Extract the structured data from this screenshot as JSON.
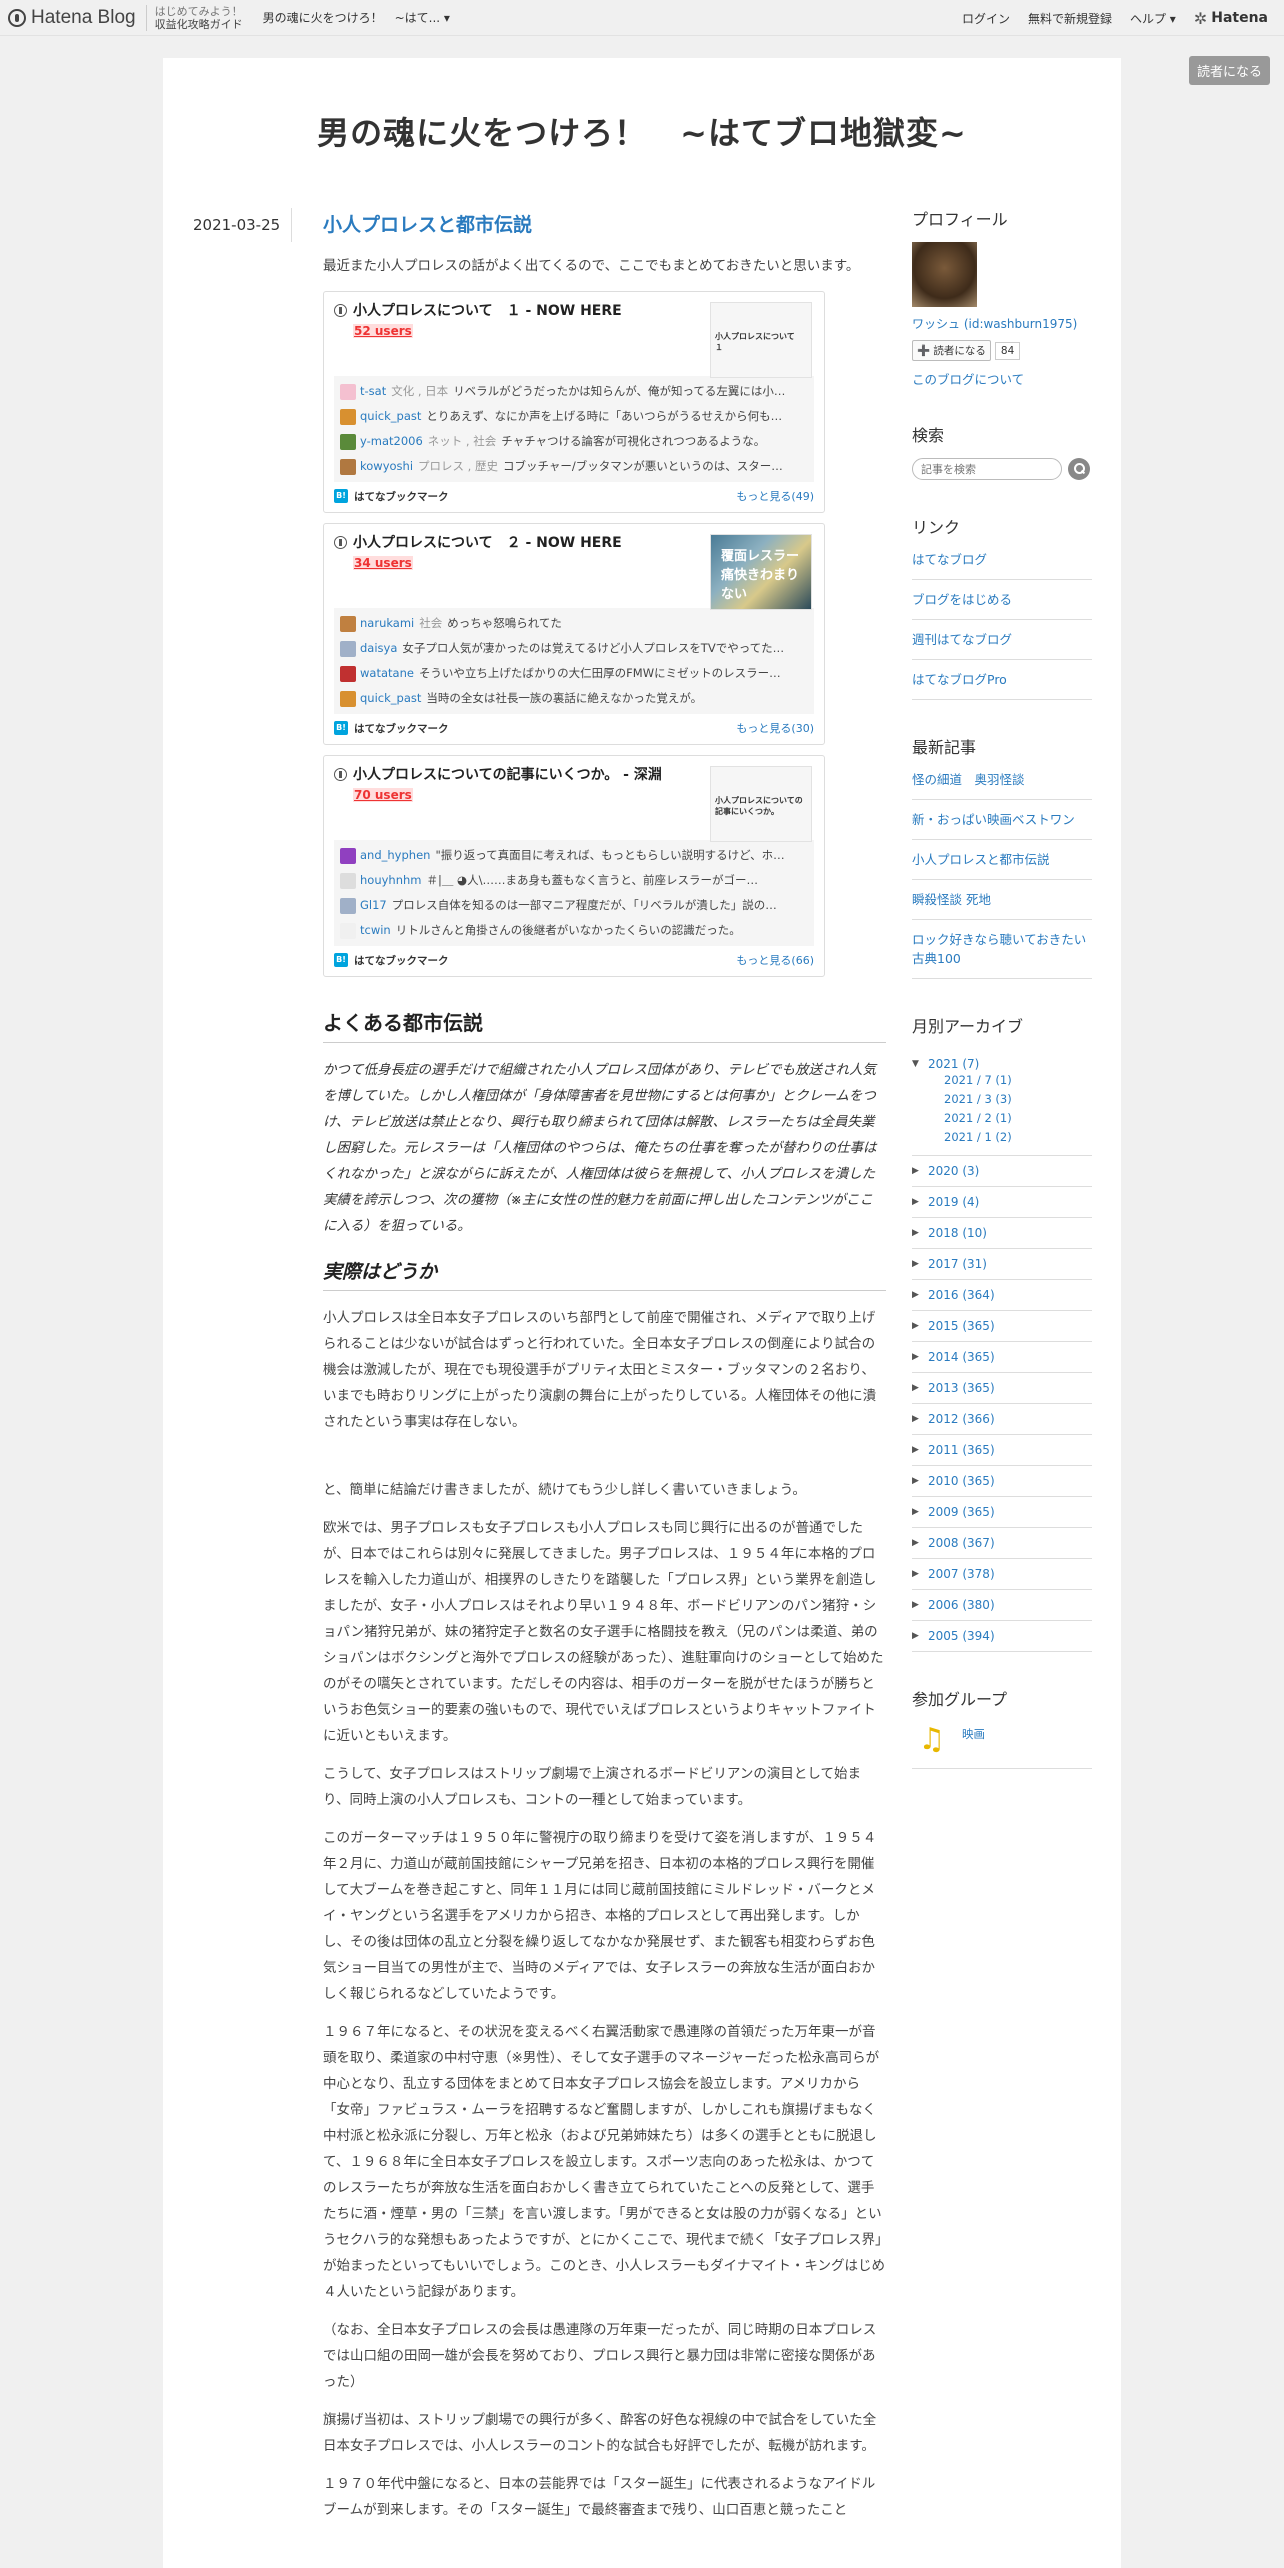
{
  "globalbar": {
    "logo_text": "Hatena Blog",
    "guide_small": "はじめてみよう！",
    "guide": "収益化攻略ガイド",
    "blog_short": "男の魂に火をつけろ！　~はて... ▾",
    "login": "ログイン",
    "signup": "無料で新規登録",
    "help": "ヘルプ ▾",
    "hatena": "Hatena"
  },
  "subscribe_button": "読者になる",
  "blog_title": "男の魂に火をつけろ！　~はてブロ地獄変~",
  "entry": {
    "date": "2021-03-25",
    "title": "小人プロレスと都市伝説",
    "intro": "最近また小人プロレスの話がよく出てくるので、ここでもまとめておきたいと思います。"
  },
  "bookmark_cards": [
    {
      "title": "小人プロレスについて　１ - NOW HERE",
      "users": "52 users",
      "thumb_text": "小人プロレスについて　１",
      "thumb_style": "text",
      "comments": [
        {
          "user": "t-sat",
          "tags": "文化 , 日本",
          "text": "リベラルがどうだったかは知らんが、俺が知ってる左翼には小…",
          "color": "#f4c0d0"
        },
        {
          "user": "quick_past",
          "tags": "",
          "text": "とりあえず、なにか声を上げる時に「あいつらがうるせえから何も…",
          "color": "#d89030"
        },
        {
          "user": "y-mat2006",
          "tags": "ネット , 社会",
          "text": "チャチャつける論客が可視化されつつあるような。",
          "color": "#5a8a3a"
        },
        {
          "user": "kowyoshi",
          "tags": "プロレス , 歴史",
          "text": "コブッチャー/ブッタマンが悪いというのは、スター…",
          "color": "#b07840"
        }
      ],
      "footer": "はてなブックマーク",
      "more": "もっと見る(49)"
    },
    {
      "title": "小人プロレスについて　２ - NOW HERE",
      "users": "34 users",
      "thumb_text": "覆面レスラー 痛快きわまりない",
      "thumb_style": "image",
      "comments": [
        {
          "user": "narukami",
          "tags": "社会",
          "text": "めっちゃ怒鳴られてた",
          "color": "#c08040"
        },
        {
          "user": "daisya",
          "tags": "",
          "text": "女子プロ人気が凄かったのは覚えてるけど小人プロレスをTVでやってた…",
          "color": "#a0b0c8"
        },
        {
          "user": "watatane",
          "tags": "",
          "text": "そういや立ち上げたばかりの大仁田厚のFMWにミゼットのレスラー…",
          "color": "#c03030"
        },
        {
          "user": "quick_past",
          "tags": "",
          "text": "当時の全女は社長一族の裏話に絶えなかった覚えが。",
          "color": "#d89030"
        }
      ],
      "footer": "はてなブックマーク",
      "more": "もっと見る(30)"
    },
    {
      "title": "小人プロレスについての記事にいくつか。 - 深淵",
      "users": "70 users",
      "thumb_text": "小人プロレスについての記事にいくつか。",
      "thumb_style": "text",
      "comments": [
        {
          "user": "and_hyphen",
          "tags": "",
          "text": "\"振り返って真面目に考えれば、もっともらしい説明するけど、ホ…",
          "color": "#9040c0"
        },
        {
          "user": "houyhnhm",
          "tags": "",
          "text": "＃|＿ ◕人\\……まあ身も蓋もなく言うと、前座レスラーがゴー…",
          "color": "#dddddd"
        },
        {
          "user": "Gl17",
          "tags": "",
          "text": "プロレス自体を知るのは一部マニア程度だが、「リベラルが潰した」説の…",
          "color": "#a0b0c8"
        },
        {
          "user": "tcwin",
          "tags": "",
          "text": "リトルさんと角掛さんの後継者がいなかったくらいの認識だった。",
          "color": "#f0f0f0"
        }
      ],
      "footer": "はてなブックマーク",
      "more": "もっと見る(66)"
    }
  ],
  "section1": {
    "heading": "よくある都市伝説",
    "text": "かつて低身長症の選手だけで組織された小人プロレス団体があり、テレビでも放送され人気を博していた。しかし人権団体が「身体障害者を見世物にするとは何事か」とクレームをつけ、テレビ放送は禁止となり、興行も取り締まられて団体は解散、レスラーたちは全員失業し困窮した。元レスラーは「人権団体のやつらは、俺たちの仕事を奪ったが替わりの仕事はくれなかった」と涙ながらに訴えたが、人権団体は彼らを無視して、小人プロレスを潰した実績を誇示しつつ、次の獲物（※主に女性の性的魅力を前面に押し出したコンテンツがここに入る）を狙っている。"
  },
  "section2": {
    "heading": "実際はどうか",
    "paragraphs": [
      "小人プロレスは全日本女子プロレスのいち部門として前座で開催され、メディアで取り上げられることは少ないが試合はずっと行われていた。全日本女子プロレスの倒産により試合の機会は激減したが、現在でも現役選手がプリティ太田とミスター・ブッタマンの２名おり、いまでも時おりリングに上がったり演劇の舞台に上がったりしている。人権団体その他に潰されたという事実は存在しない。",
      "と、簡単に結論だけ書きましたが、続けてもう少し詳しく書いていきましょう。",
      " 欧米では、男子プロレスも女子プロレスも小人プロレスも同じ興行に出るのが普通でしたが、日本ではこれらは別々に発展してきました。男子プロレスは、１９５４年に本格的プロレスを輸入した力道山が、相撲界のしきたりを踏襲した「プロレス界」という業界を創造しましたが、女子・小人プロレスはそれより早い１９４８年、ボードビリアンのパン猪狩・ショパン猪狩兄弟が、妹の猪狩定子と数名の女子選手に格闘技を教え（兄のパンは柔道、弟のショパンはボクシングと海外でプロレスの経験があった）、進駐軍向けのショーとして始めたのがその嚆矢とされています。ただしその内容は、相手のガーターを脱がせたほうが勝ちというお色気ショー的要素の強いもので、現代でいえばプロレスというよりキャットファイトに近いともいえます。",
      "こうして、女子プロレスはストリップ劇場で上演されるボードビリアンの演目として始まり、同時上演の小人プロレスも、コントの一種として始まっています。",
      "このガーターマッチは１９５０年に警視庁の取り締まりを受けて姿を消しますが、１９５４年２月に、力道山が蔵前国技館にシャープ兄弟を招き、日本初の本格的プロレス興行を開催して大ブームを巻き起こすと、同年１１月には同じ蔵前国技館にミルドレッド・バークとメイ・ヤングという名選手をアメリカから招き、本格的プロレスとして再出発します。しかし、その後は団体の乱立と分裂を繰り返してなかなか発展せず、また観客も相変わらずお色気ショー目当ての男性が主で、当時のメディアでは、女子レスラーの奔放な生活が面白おかしく報じられるなどしていたようです。",
      "１９６７年になると、その状況を変えるべく右翼活動家で愚連隊の首領だった万年東一が音頭を取り、柔道家の中村守恵（※男性）、そして女子選手のマネージャーだった松永高司らが中心となり、乱立する団体をまとめて日本女子プロレス協会を設立します。アメリカから「女帝」ファビュラス・ムーラを招聘するなど奮闘しますが、しかしこれも旗揚げまもなく中村派と松永派に分裂し、万年と松永（および兄弟姉妹たち）は多くの選手とともに脱退して、１９６８年に全日本女子プロレスを設立します。スポーツ志向のあった松永は、かつてのレスラーたちが奔放な生活を面白おかしく書き立てられていたことへの反発として、選手たちに酒・煙草・男の「三禁」を言い渡します。「男ができると女は股の力が弱くなる」というセクハラ的な発想もあったようですが、とにかくここで、現代まで続く「女子プロレス界」が始まったといってもいいでしょう。このとき、小人レスラーもダイナマイト・キングはじめ４人いたという記録があります。",
      "（なお、全日本女子プロレスの会長は愚連隊の万年東一だったが、同じ時期の日本プロレスでは山口組の田岡一雄が会長を努めており、プロレス興行と暴力団は非常に密接な関係があった）",
      "旗揚げ当初は、ストリップ劇場での興行が多く、酔客の好色な視線の中で試合をしていた全日本女子プロレスでは、小人レスラーのコント的な試合も好評でしたが、転機が訪れます。",
      "１９７０年代中盤になると、日本の芸能界では「スター誕生」に代表されるようなアイドルブームが到来します。その「スター誕生」で最終審査まで残り、山口百恵と競ったこと"
    ]
  },
  "sidebar": {
    "profile": {
      "heading": "プロフィール",
      "name": "ワッシュ (id:washburn1975)",
      "subscribe": "➕ 読者になる",
      "count": "84",
      "about": "このブログについて"
    },
    "search": {
      "heading": "検索",
      "placeholder": "記事を検索"
    },
    "links": {
      "heading": "リンク",
      "items": [
        "はてなブログ",
        "ブログをはじめる",
        "週刊はてなブログ",
        "はてなブログPro"
      ]
    },
    "recent": {
      "heading": "最新記事",
      "items": [
        "怪の細道　奥羽怪談",
        "新・おっぱい映画ベストワン",
        "小人プロレスと都市伝説",
        "瞬殺怪談 死地",
        "ロック好きなら聴いておきたい古典100"
      ]
    },
    "archive": {
      "heading": "月別アーカイブ",
      "open_year": "2021 (7)",
      "open_months": [
        "2021 / 7 (1)",
        "2021 / 3 (3)",
        "2021 / 2 (1)",
        "2021 / 1 (2)"
      ],
      "years": [
        "2020 (3)",
        "2019 (4)",
        "2018 (10)",
        "2017 (31)",
        "2016 (364)",
        "2015 (365)",
        "2014 (365)",
        "2013 (365)",
        "2012 (366)",
        "2011 (365)",
        "2010 (365)",
        "2009 (365)",
        "2008 (367)",
        "2007 (378)",
        "2006 (380)",
        "2005 (394)"
      ]
    },
    "groups": {
      "heading": "参加グループ",
      "items": [
        "映画"
      ]
    }
  }
}
